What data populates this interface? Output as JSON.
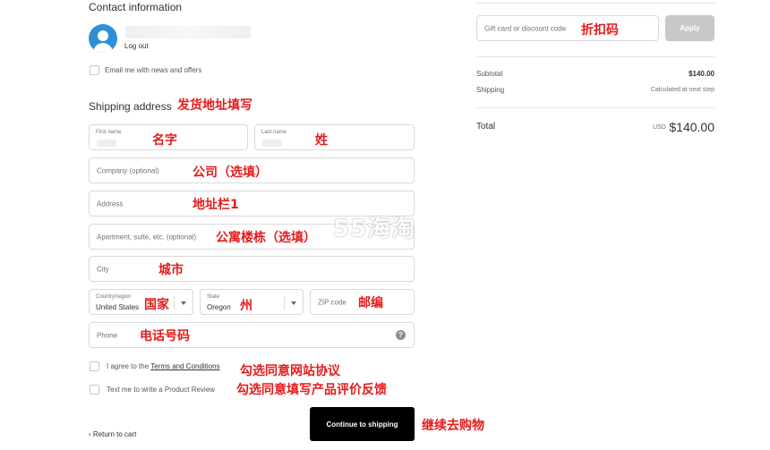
{
  "contact": {
    "title": "Contact information",
    "logout_label": "Log out",
    "newsletter_label": "Email me with news and offers"
  },
  "shipping": {
    "title": "Shipping address",
    "first_name": {
      "label": "First name"
    },
    "last_name": {
      "label": "Last name"
    },
    "company_placeholder": "Company (optional)",
    "address_placeholder": "Address",
    "apartment_placeholder": "Apartment, suite, etc. (optional)",
    "city_placeholder": "City",
    "country": {
      "label": "Country/region",
      "value": "United States"
    },
    "state": {
      "label": "State",
      "value": "Oregon"
    },
    "zip_placeholder": "ZIP code",
    "phone_placeholder": "Phone",
    "help_glyph": "?"
  },
  "consent": {
    "terms_prefix": "I agree to the",
    "terms_link": "Terms and Conditions",
    "review_label": "Text me to write a Product Review"
  },
  "actions": {
    "return_label": "Return to cart",
    "return_glyph": "‹",
    "continue_label": "Continue to shipping"
  },
  "summary": {
    "discount_placeholder": "Gift card or discount code",
    "apply_label": "Apply",
    "subtotal_label": "Subtotal",
    "subtotal_value": "$140.00",
    "shipping_label": "Shipping",
    "shipping_value": "Calculated at next step",
    "total_label": "Total",
    "total_currency": "USD",
    "total_value": "$140.00"
  },
  "annotations": {
    "discount": "折扣码",
    "shipping_address": "发货地址填写",
    "first_name": "名字",
    "last_name": "姓",
    "company": "公司（选填）",
    "address": "地址栏1",
    "apartment": "公寓楼栋（选填）",
    "city": "城市",
    "country": "国家",
    "state": "州",
    "zip": "邮编",
    "phone": "电话号码",
    "terms": "勾选同意网站协议",
    "review": "勾选同意填写产品评价反馈",
    "continue": "继续去购物"
  },
  "watermark": "55海淘",
  "colors": {
    "annotation": "#e51b1b",
    "avatar": "#2f8fd6",
    "primary_button": "#000000",
    "apply_button": "#c8c8c8"
  }
}
